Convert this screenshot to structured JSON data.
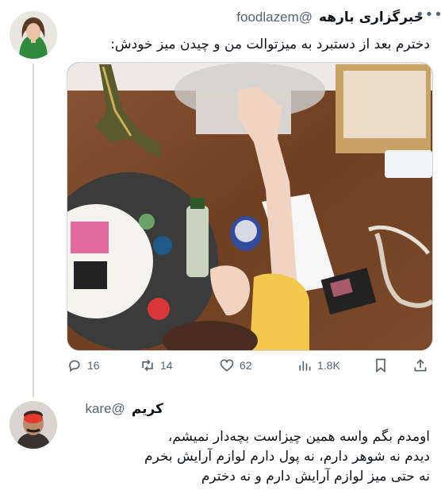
{
  "tweet": {
    "author_name": "خبرگزاری بارهه",
    "author_handle": "@foodlazem",
    "more_icon": "more-dots-icon",
    "text": "دخترم بعد از دستبرد به میزتوالت من و چیدن میز خودش:",
    "actions": {
      "replies": "16",
      "retweets": "14",
      "likes": "62",
      "views": "1.8K"
    },
    "icons": {
      "reply": "reply-icon",
      "retweet": "retweet-icon",
      "like": "heart-icon",
      "views": "views-chart-icon",
      "bookmark": "bookmark-icon",
      "share": "share-icon"
    }
  },
  "reply": {
    "author_name": "کریم",
    "author_handle": "@kare",
    "lines": [
      "اومدم بگم واسه همین چیزاست بچه‌دار نمیشم،",
      "دیدم نه شوهر دارم، نه پول دارم لوازم آرایش بخرم",
      "نه حتی میز لوازم آرایش دارم و نه دخترم"
    ]
  },
  "colors": {
    "text": "#0f1419",
    "secondary": "#536471",
    "border": "#cfd9de"
  }
}
